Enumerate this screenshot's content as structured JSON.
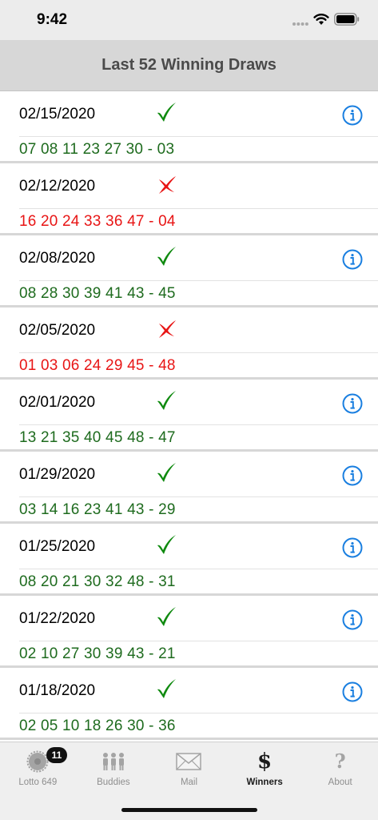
{
  "status_bar": {
    "time": "9:42"
  },
  "header": {
    "title": "Last 52 Winning Draws"
  },
  "draws": [
    {
      "date": "02/15/2020",
      "numbers": "07 08 11 23 27 30 - 03",
      "won": true,
      "has_info": true
    },
    {
      "date": "02/12/2020",
      "numbers": "16 20 24 33 36 47 - 04",
      "won": false,
      "has_info": false
    },
    {
      "date": "02/08/2020",
      "numbers": "08 28 30 39 41 43 - 45",
      "won": true,
      "has_info": true
    },
    {
      "date": "02/05/2020",
      "numbers": "01 03 06 24 29 45 - 48",
      "won": false,
      "has_info": false
    },
    {
      "date": "02/01/2020",
      "numbers": "13 21 35 40 45 48 - 47",
      "won": true,
      "has_info": true
    },
    {
      "date": "01/29/2020",
      "numbers": "03 14 16 23 41 43 - 29",
      "won": true,
      "has_info": true
    },
    {
      "date": "01/25/2020",
      "numbers": "08 20 21 30 32 48 - 31",
      "won": true,
      "has_info": true
    },
    {
      "date": "01/22/2020",
      "numbers": "02 10 27 30 39 43 - 21",
      "won": true,
      "has_info": true
    },
    {
      "date": "01/18/2020",
      "numbers": "02 05 10 18 26 30 - 36",
      "won": true,
      "has_info": true
    }
  ],
  "tab_bar": {
    "tabs": [
      {
        "id": "lotto",
        "label": "Lotto 649",
        "icon": "lotto-wheel-icon",
        "badge": "11",
        "active": false
      },
      {
        "id": "buddies",
        "label": "Buddies",
        "icon": "people-icon",
        "active": false
      },
      {
        "id": "mail",
        "label": "Mail",
        "icon": "envelope-icon",
        "active": false
      },
      {
        "id": "winners",
        "label": "Winners",
        "icon": "dollar-icon",
        "active": true
      },
      {
        "id": "about",
        "label": "About",
        "icon": "question-icon",
        "active": false
      }
    ]
  },
  "colors": {
    "win_numbers": "#1e6b1e",
    "lose_numbers": "#e81515",
    "check": "#0f8a0f",
    "cross": "#e81515",
    "info": "#1a7fe0",
    "header_bg": "#d7d7d7"
  }
}
